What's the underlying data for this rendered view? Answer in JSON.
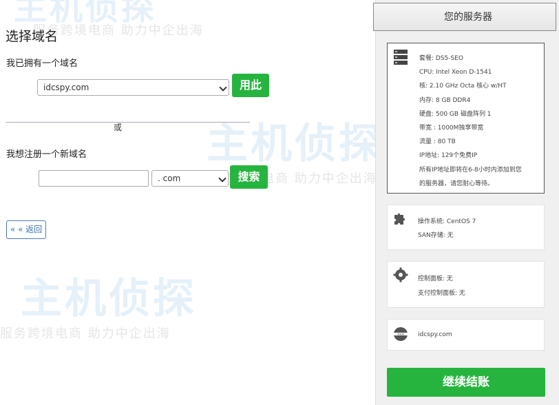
{
  "page": {
    "title": "选择域名",
    "back_label": "« « 返回"
  },
  "own_domain": {
    "label": "我已拥有一个域名",
    "selected": "idcspy.com",
    "use_button": "用此"
  },
  "divider": {
    "or_label": "或"
  },
  "register": {
    "label": "我想注册一个新域名",
    "input_value": "",
    "tld_selected": ". com",
    "search_button": "搜索"
  },
  "sidebar": {
    "header": "您的服务器",
    "server": {
      "lines": [
        "套餐: DS5-SEO",
        "CPU: Intel Xeon D-1541",
        "核: 2.10 GHz Octa 核心 w/HT",
        "内存: 8 GB DDR4",
        "硬盘: 500 GB 磁盘阵列 1",
        "带宽 : 1000M独享带宽",
        "流量 : 80 TB",
        "IP地址: 129个免费IP",
        "所有IP地址即将在6-8小时内添加到您",
        "的服务器，请您耐心等待。"
      ]
    },
    "os": {
      "lines": [
        "操作系统: CentOS 7",
        "SAN存储: 无"
      ]
    },
    "panel": {
      "lines": [
        "控制面板: 无",
        "支付控制面板: 无"
      ]
    },
    "domain": {
      "line": "idcspy.com"
    },
    "checkout_button": "继续结账"
  },
  "watermark": {
    "big": "主机侦探",
    "small": "服务跨境电商 助力中企出海"
  },
  "colors": {
    "accent_green": "#26b43f",
    "link_blue": "#3c76a8"
  },
  "icons": [
    "server-icon",
    "puzzle-icon",
    "gear-icon",
    "globe-icon",
    "chevron-down-icon"
  ]
}
